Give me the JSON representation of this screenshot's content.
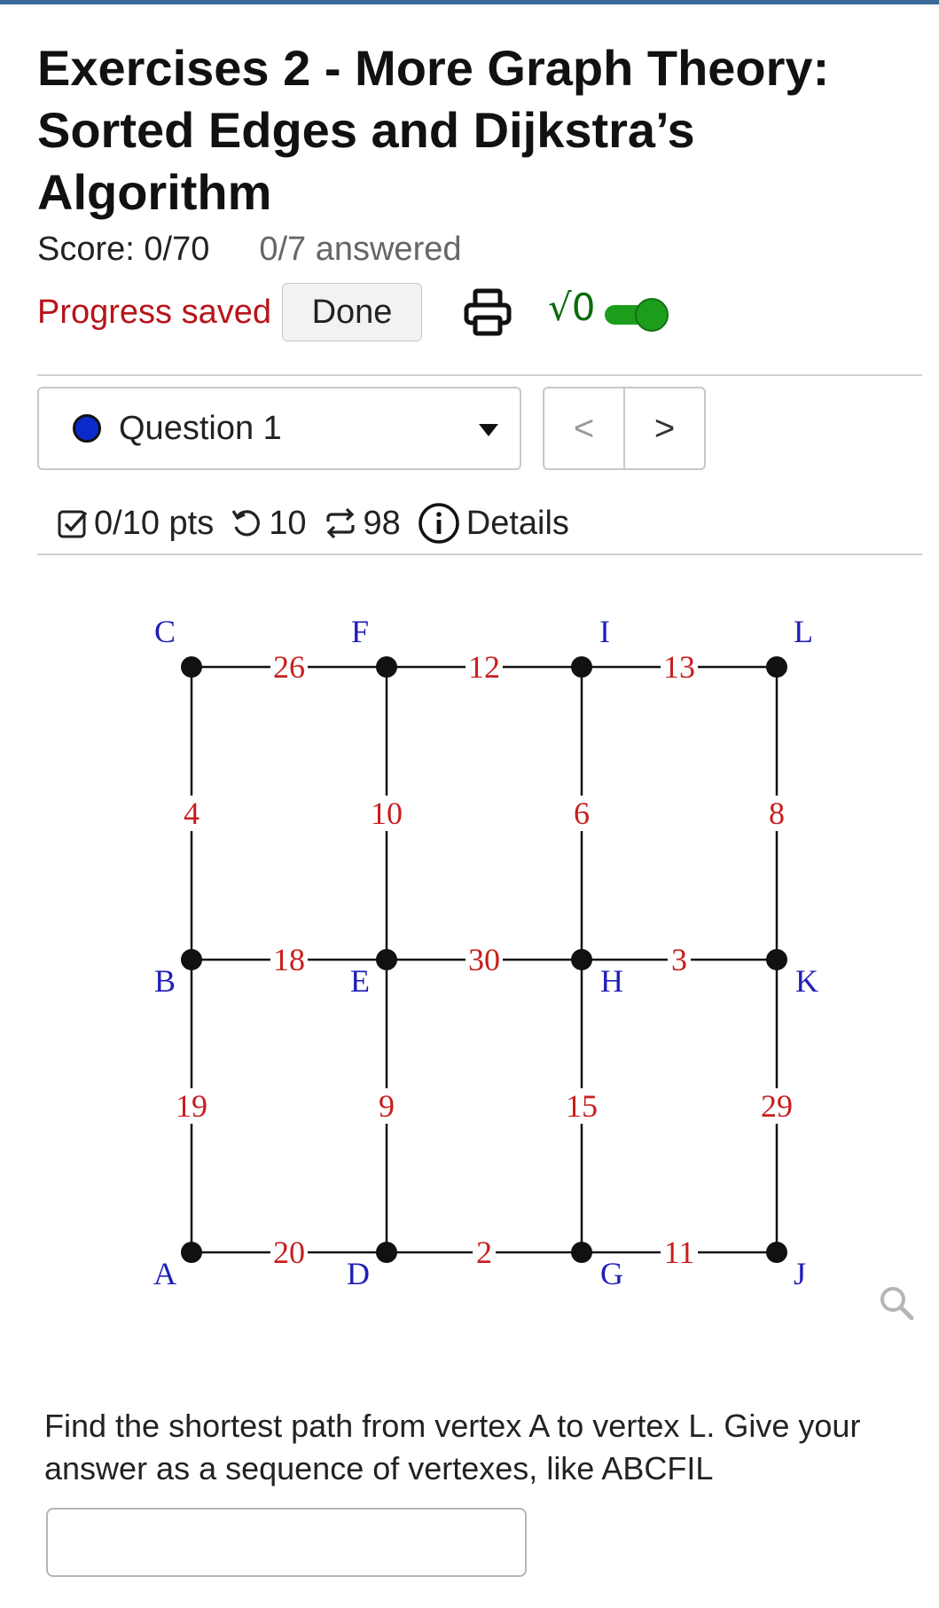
{
  "header": {
    "title": "Exercises 2 - More Graph Theory: Sorted Edges and Dijkstra’s Algorithm",
    "score": "Score: 0/70",
    "answered": "0/7 answered",
    "progress": "Progress saved",
    "done_label": "Done",
    "math_toggle_glyph": "√0",
    "math_toggle_on": true,
    "accent_color": "#1c9e1c"
  },
  "question_nav": {
    "selected": "Question 1",
    "prev_glyph": "<",
    "next_glyph": ">"
  },
  "question_info": {
    "points": "0/10 pts",
    "retries": "10",
    "regens": "98",
    "details_label": "Details"
  },
  "graph": {
    "vertices": [
      {
        "id": "C",
        "label": "C"
      },
      {
        "id": "F",
        "label": "F"
      },
      {
        "id": "I",
        "label": "I"
      },
      {
        "id": "L",
        "label": "L"
      },
      {
        "id": "B",
        "label": "B"
      },
      {
        "id": "E",
        "label": "E"
      },
      {
        "id": "H",
        "label": "H"
      },
      {
        "id": "K",
        "label": "K"
      },
      {
        "id": "A",
        "label": "A"
      },
      {
        "id": "D",
        "label": "D"
      },
      {
        "id": "G",
        "label": "G"
      },
      {
        "id": "J",
        "label": "J"
      }
    ],
    "edges": [
      {
        "from": "C",
        "to": "F",
        "weight": "26"
      },
      {
        "from": "F",
        "to": "I",
        "weight": "12"
      },
      {
        "from": "I",
        "to": "L",
        "weight": "13"
      },
      {
        "from": "C",
        "to": "B",
        "weight": "4"
      },
      {
        "from": "F",
        "to": "E",
        "weight": "10"
      },
      {
        "from": "I",
        "to": "H",
        "weight": "6"
      },
      {
        "from": "L",
        "to": "K",
        "weight": "8"
      },
      {
        "from": "B",
        "to": "E",
        "weight": "18"
      },
      {
        "from": "E",
        "to": "H",
        "weight": "30"
      },
      {
        "from": "H",
        "to": "K",
        "weight": "3"
      },
      {
        "from": "B",
        "to": "A",
        "weight": "19"
      },
      {
        "from": "E",
        "to": "D",
        "weight": "9"
      },
      {
        "from": "H",
        "to": "G",
        "weight": "15"
      },
      {
        "from": "K",
        "to": "J",
        "weight": "29"
      },
      {
        "from": "A",
        "to": "D",
        "weight": "20"
      },
      {
        "from": "D",
        "to": "G",
        "weight": "2"
      },
      {
        "from": "G",
        "to": "J",
        "weight": "11"
      }
    ],
    "vertex_label_color": "#1f1fb8",
    "weight_label_color": "#c81e1e"
  },
  "question": {
    "prompt": "Find the shortest path from vertex A to vertex L. Give your answer as a sequence of vertexes, like ABCFIL",
    "answer_value": ""
  }
}
